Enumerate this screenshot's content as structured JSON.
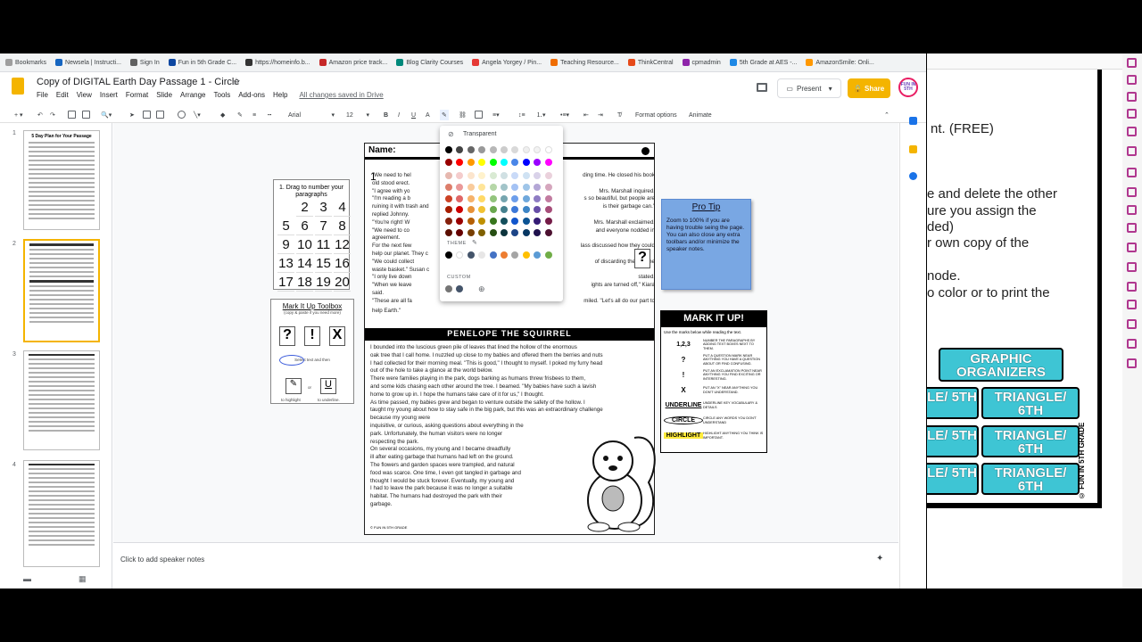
{
  "bookmarks": [
    "Bookmarks",
    "Newsela | Instructi...",
    "Sign In",
    "Fun in 5th Grade C...",
    "https://homeinfo.b...",
    "Amazon price track...",
    "Blog Clarity Courses",
    "Angela Yorgey / Pin...",
    "Teaching Resource...",
    "ThinkCentral",
    "cpmadmin",
    "5th Grade at AES -...",
    "AmazonSmile: Onli..."
  ],
  "doc": {
    "title": "Copy of DIGITAL Earth Day Passage 1 - Circle",
    "menus": [
      "File",
      "Edit",
      "View",
      "Insert",
      "Format",
      "Slide",
      "Arrange",
      "Tools",
      "Add-ons",
      "Help"
    ],
    "saved": "All changes saved in Drive",
    "present": "Present",
    "share": "Share",
    "avatar": "FUN IN 5TH"
  },
  "toolbar": {
    "font": "Arial",
    "size": "12",
    "format_options": "Format options",
    "animate": "Animate"
  },
  "filmstrip": {
    "numbers": [
      "1",
      "2",
      "3",
      "4"
    ],
    "slide1_title": "5 Day Plan for Your Passage"
  },
  "notes": "Click to add speaker notes",
  "slide": {
    "name_label": "Name:",
    "para1": [
      "\"We need to hel",
      "old stood erect.",
      "\"I agree with yo",
      "\"I'm reading a b",
      "ruining it with trash and",
      "replied Johnny.",
      "\"You're right! W",
      "\"We need to co",
      "agreement.",
      "For the next few",
      "help our planet. They c",
      "\"We could collect",
      "waste basket.\" Susan c",
      "\"I only live down",
      "\"When we leave",
      "said.",
      "\"These are all fa"
    ],
    "para1_right": [
      "ding time. He closed his book",
      "",
      "Mrs. Marshall inquired.",
      "s so beautiful, but people are",
      "is their garbage can.\"",
      "",
      "Mrs. Marshall exclaimed.",
      "and everyone nodded in",
      "",
      "lass discussed how they could",
      "",
      "of discarding them in the",
      "",
      "stated.",
      "ights are turned off,\" Kiara",
      "",
      "miled. \"Let's all do our part to"
    ],
    "para1_end": "help Earth.\"",
    "penelope_title": "PENELOPE THE SQUIRREL",
    "para2": [
      "I bounded into the luscious green pile of leaves that lined the hollow of the enormous",
      "oak tree that I call home. I nuzzled up close to my babies and offered them the berries and nuts",
      "I had collected for their morning meal. \"This is good,\" I thought to myself. I poked my furry head",
      "out of the hole to take a glance at the world below.",
      "There were families playing in the park, dogs barking as humans threw frisbees to them,",
      "and some kids chasing each other around the tree. I beamed. \"My babies have such a lavish",
      "home to grow up in. I hope the humans take care of it for us,\" I thought.",
      "As time passed, my babies grew and began to venture outside the safety of the hollow. I",
      "taught my young about how to stay safe in the big park, but this was an extraordinary challenge",
      "because my young were",
      "inquisitive, or curious, asking questions about everything in the",
      "park. Unfortunately, the human visitors were no longer",
      "respecting the park.",
      "On several occasions, my young and I became dreadfully",
      "ill after eating garbage that humans had left on the ground.",
      "The flowers and garden spaces were trampled, and natural",
      "food was scarce. One time, I even got tangled in garbage and",
      "thought I would be stuck forever. Eventually, my young and",
      "I had to leave the park because it was no longer a suitable",
      "habitat. The humans had destroyed the park with their",
      "garbage."
    ],
    "footer": "© FUN IN 5TH GRADE"
  },
  "dragbox": {
    "header": "1. Drag to number your paragraphs",
    "numbers": [
      "2",
      "3",
      "4",
      "5",
      "6",
      "7",
      "8",
      "9",
      "10",
      "11",
      "12",
      "13",
      "14",
      "15",
      "16",
      "17",
      "18",
      "19",
      "20"
    ]
  },
  "toolbox": {
    "title": "Mark It Up Toolbox",
    "subtitle": "(copy & paste if you need more)",
    "symbols": [
      "?",
      "!",
      "X"
    ],
    "select_text": "Select text and then",
    "highlight": "to highlight",
    "or": "or",
    "underline": "to underline."
  },
  "protip": {
    "title": "Pro Tip",
    "body": "Zoom to 100% if you are having trouble seing the page. You can also close any extra toolbars and/or minimize the speaker notes."
  },
  "markit": {
    "title": "MARK IT UP!",
    "subtitle": "Use the marks below while reading the text.",
    "rows": [
      {
        "k": "1,2,3",
        "d": "NUMBER THE PARAGRAPHS BY ADDING TEXT BOXES NEXT TO THEM."
      },
      {
        "k": "?",
        "d": "PUT A QUESTION MARK NEAR ANYTHING YOU HAVE A QUESTION ABOUT OR FIND CONFUSING."
      },
      {
        "k": "!",
        "d": "PUT AN EXCLAMATION POINT NEAR ANYTHING YOU FIND EXCITING OR INTERESTING."
      },
      {
        "k": "X",
        "d": "PUT AN \"X\" NEAR ANYTHING YOU DON'T UNDERSTAND."
      },
      {
        "k": "UNDERLINE",
        "d": "UNDERLINE KEY VOCABULARY & DETAILS"
      },
      {
        "k": "CIRCLE",
        "d": "CIRCLE ANY WORDS YOU DON'T UNDERSTAND"
      },
      {
        "k": "HIGHLIGHT",
        "d": "HIGHLIGHT ANYTHING YOU THINK IS IMPORTANT."
      }
    ]
  },
  "picker": {
    "transparent": "Transparent",
    "theme_label": "THEME",
    "custom_label": "CUSTOM",
    "grays": [
      "#000000",
      "#434343",
      "#666666",
      "#999999",
      "#b7b7b7",
      "#cccccc",
      "#d9d9d9",
      "#efefef",
      "#f3f3f3",
      "#ffffff"
    ],
    "brights": [
      "#980000",
      "#ff0000",
      "#ff9900",
      "#ffff00",
      "#00ff00",
      "#00ffff",
      "#4a86e8",
      "#0000ff",
      "#9900ff",
      "#ff00ff"
    ],
    "tints": [
      [
        "#e6b8af",
        "#f4cccc",
        "#fce5cd",
        "#fff2cc",
        "#d9ead3",
        "#d0e0e3",
        "#c9daf8",
        "#cfe2f3",
        "#d9d2e9",
        "#ead1dc"
      ],
      [
        "#dd7e6b",
        "#ea9999",
        "#f9cb9c",
        "#ffe599",
        "#b6d7a8",
        "#a2c4c9",
        "#a4c2f4",
        "#9fc5e8",
        "#b4a7d6",
        "#d5a6bd"
      ],
      [
        "#cc4125",
        "#e06666",
        "#f6b26b",
        "#ffd966",
        "#93c47d",
        "#76a5af",
        "#6d9eeb",
        "#6fa8dc",
        "#8e7cc3",
        "#c27ba0"
      ],
      [
        "#a61c00",
        "#cc0000",
        "#e69138",
        "#f1c232",
        "#6aa84f",
        "#45818e",
        "#3c78d8",
        "#3d85c6",
        "#674ea7",
        "#a64d79"
      ],
      [
        "#85200c",
        "#990000",
        "#b45f06",
        "#bf9000",
        "#38761d",
        "#134f5c",
        "#1155cc",
        "#0b5394",
        "#351c75",
        "#741b47"
      ],
      [
        "#5b0f00",
        "#660000",
        "#783f04",
        "#7f6000",
        "#274e13",
        "#0c343d",
        "#1c4587",
        "#073763",
        "#20124d",
        "#4c1130"
      ]
    ],
    "theme": [
      "#000000",
      "#ffffff",
      "#44546a",
      "#e7e6e6",
      "#4472c4",
      "#ed7d31",
      "#a5a5a5",
      "#ffc000",
      "#5b9bd5",
      "#70ad47"
    ],
    "custom": [
      "#757575",
      "#44546a"
    ]
  },
  "other_window": {
    "lines": [
      "nt. (FREE)",
      "e and delete the other",
      "ure you assign the",
      "ded)",
      "r own copy of the",
      "node.",
      "o color or to print the"
    ],
    "graphic_organizers": "GRAPHIC ORGANIZERS",
    "boxes": [
      "LE/ 5TH",
      "TRIANGLE/ 6TH",
      "LE/ 5TH",
      "TRIANGLE/ 6TH",
      "LE/ 5TH",
      "TRIANGLE/ 6TH"
    ],
    "side_text": "© FUN IN 5TH GRADE"
  }
}
